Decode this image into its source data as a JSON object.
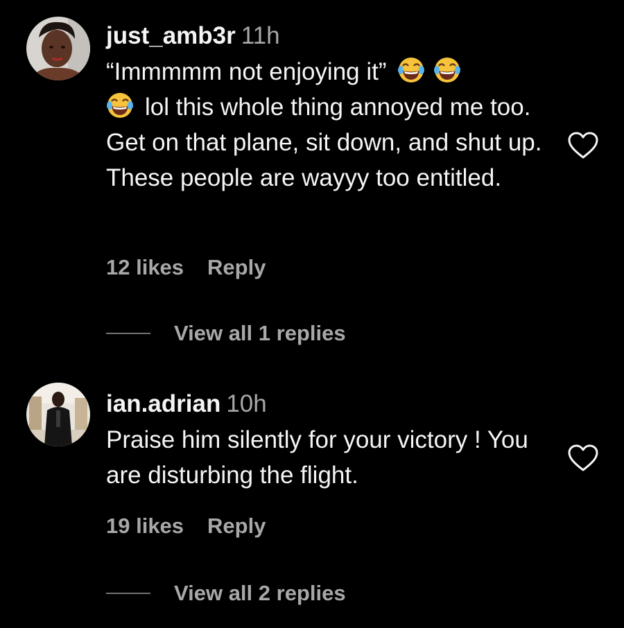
{
  "comments": [
    {
      "username": "just_amb3r",
      "time": "11h",
      "text_line1": "“Immmmm not enjoying it”",
      "emoji": "face-with-tears-of-joy",
      "text_rest": "lol this whole thing annoyed me too. Get on that plane, sit down, and shut up. These people are wayyy too entitled.",
      "likes": "12 likes",
      "reply_label": "Reply",
      "view_replies": "View all 1 replies"
    },
    {
      "username": "ian.adrian",
      "time": "10h",
      "text": "Praise him silently for your victory ! You are disturbing the flight.",
      "likes": "19 likes",
      "reply_label": "Reply",
      "view_replies": "View all 2 replies"
    }
  ],
  "colors": {
    "background": "#000000",
    "primary_text": "#f5f5f5",
    "secondary_text": "#a8a8a8",
    "divider": "#737373"
  }
}
